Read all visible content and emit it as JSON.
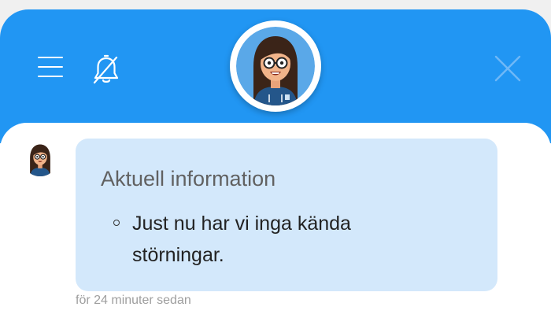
{
  "header": {
    "background_color": "#2196f3",
    "menu_icon": "hamburger-menu-icon",
    "notification_icon": "bell-off-icon",
    "close_icon": "close-x-icon"
  },
  "agent": {
    "avatar_icon": "agent-avatar"
  },
  "message": {
    "title": "Aktuell information",
    "items": [
      "Just nu har vi inga kända störningar."
    ],
    "timestamp": "för 24 minuter sedan",
    "bubble_color": "#d3e8fb"
  }
}
